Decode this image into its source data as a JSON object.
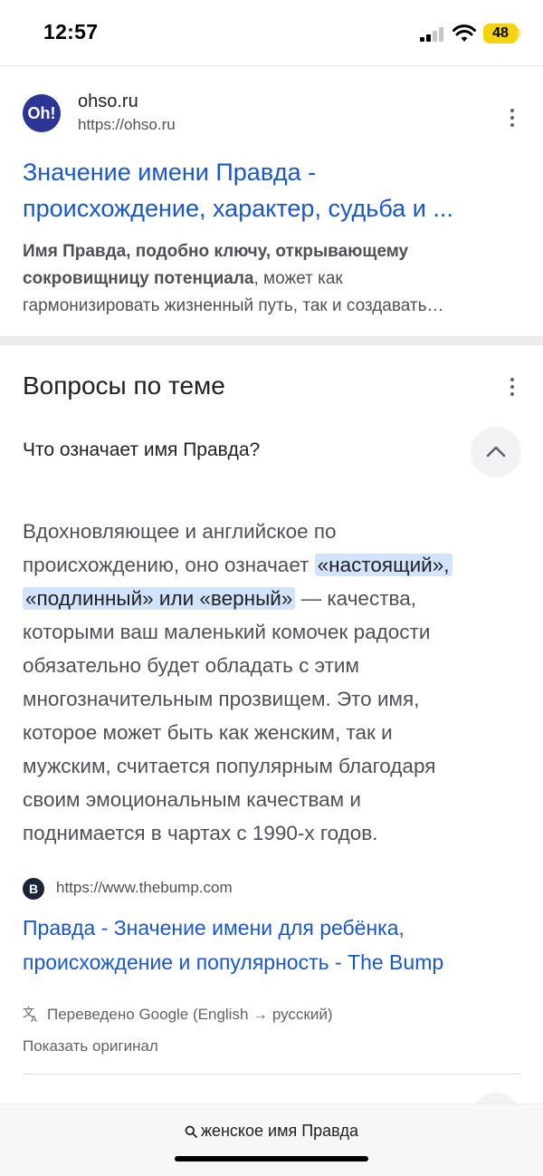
{
  "status_bar": {
    "time": "12:57",
    "battery": "48"
  },
  "result": {
    "favicon_text": "Oh!",
    "site_name": "ohso.ru",
    "url": "https://ohso.ru",
    "title_line1": "Значение имени Правда -",
    "title_line2": "происхождение, характер, судьба и ...",
    "snippet_bold1": "Имя Правда, подобно ключу, открывающему",
    "snippet_bold2": "сокровищницу потенциала",
    "snippet_rest1": ", может как",
    "snippet_rest2": "гармонизировать жизненный путь, так и создавать…"
  },
  "questions": {
    "section_title": "Вопросы по теме",
    "question": "Что означает имя Правда?",
    "answer_line1": "Вдохновляющее и английское по",
    "answer_line2_pre": "происхождению, оно означает ",
    "answer_hl1": "«настоящий»,",
    "answer_hl2": "«подлинный» или «верный»",
    "answer_line3_post": " — качества,",
    "answer_line4": "которыми ваш маленький комочек радости",
    "answer_line5": "обязательно будет обладать с этим",
    "answer_line6": "многозначительным прозвищем. Это имя,",
    "answer_line7": "которое может быть как женским, так и",
    "answer_line8": "мужским, считается популярным благодаря",
    "answer_line9": "своим эмоциональным качествам и",
    "answer_line10": "поднимается в чартах с 1990-х годов.",
    "source_icon_text": "B",
    "source_url": "https://www.thebump.com",
    "source_title_line1": "Правда - Значение имени для ребёнка,",
    "source_title_line2": "происхождение и популярность - The Bump",
    "translated_note": "Переведено Google (English → русский)",
    "show_original": "Показать оригинал"
  },
  "bottom_bar": {
    "query": "женское имя Правда"
  },
  "icons": {
    "signal": "cellular-signal-icon",
    "wifi": "wifi-icon",
    "menu": "more-vert-icon",
    "collapse": "chevron-up-icon",
    "translate": "translate-icon",
    "search": "search-icon"
  },
  "colors": {
    "link": "#1a57c8",
    "highlight": "#d2e3fc",
    "battery": "#f5d40c"
  }
}
